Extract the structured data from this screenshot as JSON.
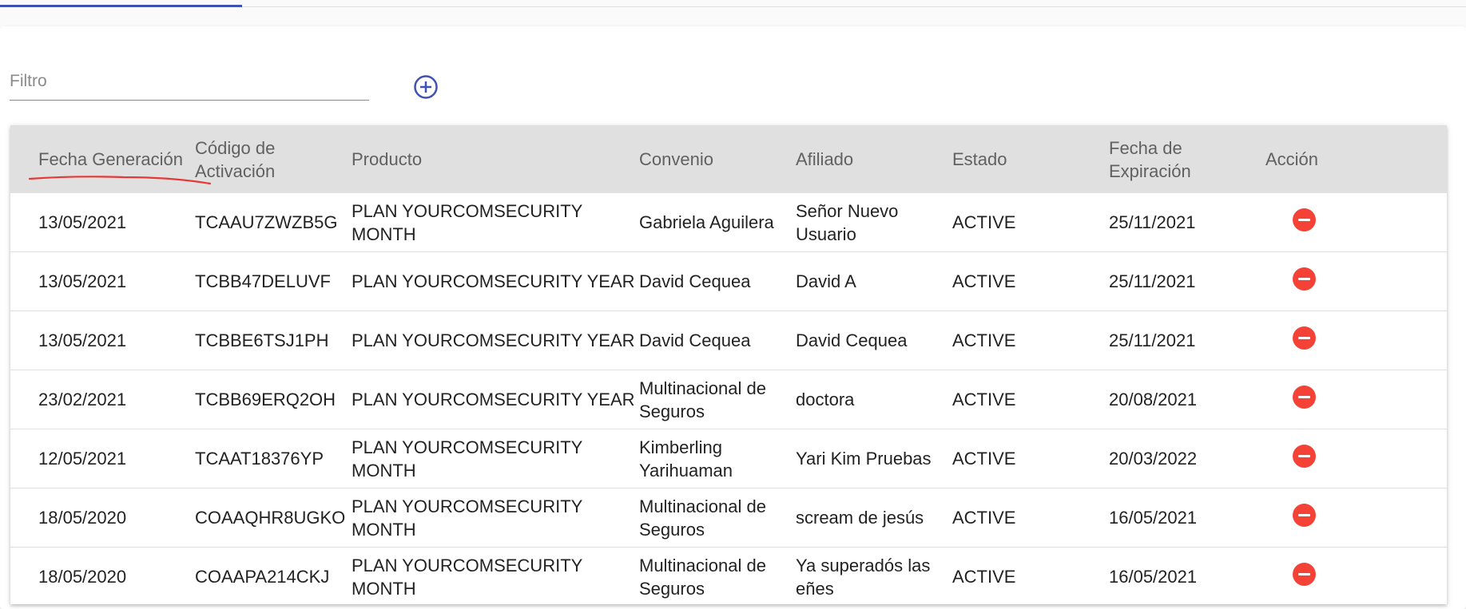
{
  "filter": {
    "placeholder": "Filtro",
    "value": ""
  },
  "add_icon": "plus-circle-icon",
  "delete_icon": "minus-circle-icon",
  "colors": {
    "accent": "#3f51b5",
    "delete": "#f44336",
    "header_bg": "#e0e0e0",
    "annotation": "#e53935"
  },
  "table": {
    "headers": [
      "Fecha Generación",
      "Código de Activación",
      "Producto",
      "Convenio",
      "Afiliado",
      "Estado",
      "Fecha de Expiración",
      "Acción"
    ],
    "rows": [
      {
        "fecha": "13/05/2021",
        "codigo": "TCAAU7ZWZB5G",
        "producto": "PLAN YOURCOMSECURITY MONTH",
        "convenio": "Gabriela Aguilera",
        "afiliado": "Señor Nuevo Usuario",
        "estado": "ACTIVE",
        "expiracion": "25/11/2021"
      },
      {
        "fecha": "13/05/2021",
        "codigo": "TCBB47DELUVF",
        "producto": "PLAN YOURCOMSECURITY YEAR",
        "convenio": "David Cequea",
        "afiliado": "David A",
        "estado": "ACTIVE",
        "expiracion": "25/11/2021"
      },
      {
        "fecha": "13/05/2021",
        "codigo": "TCBBE6TSJ1PH",
        "producto": "PLAN YOURCOMSECURITY YEAR",
        "convenio": "David Cequea",
        "afiliado": "David Cequea",
        "estado": "ACTIVE",
        "expiracion": "25/11/2021"
      },
      {
        "fecha": "23/02/2021",
        "codigo": "TCBB69ERQ2OH",
        "producto": "PLAN YOURCOMSECURITY YEAR",
        "convenio": "Multinacional de Seguros",
        "afiliado": "doctora",
        "estado": "ACTIVE",
        "expiracion": "20/08/2021"
      },
      {
        "fecha": "12/05/2021",
        "codigo": "TCAAT18376YP",
        "producto": "PLAN YOURCOMSECURITY MONTH",
        "convenio": "Kimberling Yarihuaman",
        "afiliado": "Yari Kim Pruebas",
        "estado": "ACTIVE",
        "expiracion": "20/03/2022"
      },
      {
        "fecha": "18/05/2020",
        "codigo": "COAAQHR8UGKO",
        "producto": "PLAN YOURCOMSECURITY MONTH",
        "convenio": "Multinacional de Seguros",
        "afiliado": "scream de jesús",
        "estado": "ACTIVE",
        "expiracion": "16/05/2021"
      },
      {
        "fecha": "18/05/2020",
        "codigo": "COAAPA214CKJ",
        "producto": "PLAN YOURCOMSECURITY MONTH",
        "convenio": "Multinacional de Seguros",
        "afiliado": "Ya superadós las eñes",
        "estado": "ACTIVE",
        "expiracion": "16/05/2021"
      }
    ]
  }
}
